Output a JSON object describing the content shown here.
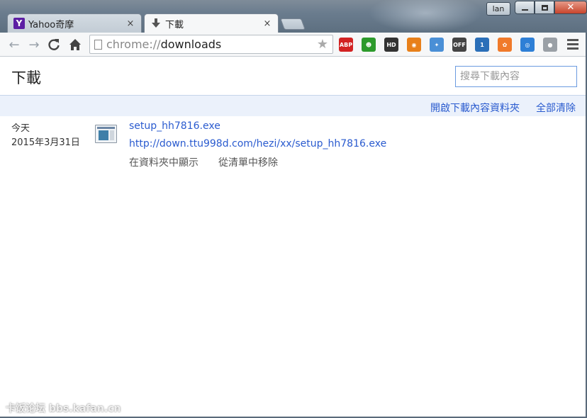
{
  "window": {
    "user_label": "lan",
    "close_glyph": "✕"
  },
  "tabs": [
    {
      "title": "Yahoo奇摩",
      "favicon": "Y",
      "icon": "yahoo-icon",
      "active": false
    },
    {
      "title": "下載",
      "favicon": "🡇",
      "icon": "download-arrow-icon",
      "active": true
    }
  ],
  "tab_close_glyph": "×",
  "toolbar": {
    "back_glyph": "←",
    "forward_glyph": "→",
    "reload_glyph": "C",
    "home_glyph": "⌂",
    "url_scheme": "chrome://",
    "url_host": "downloads",
    "star_glyph": "★",
    "extensions": [
      {
        "name": "adblock-plus-icon",
        "text": "ABP",
        "color": "#d22222"
      },
      {
        "name": "green-face-icon",
        "text": "☻",
        "color": "#2c9a2c"
      },
      {
        "name": "hd-icon",
        "text": "HD",
        "color": "#333333"
      },
      {
        "name": "orange-circle-icon",
        "text": "◉",
        "color": "#e8801a"
      },
      {
        "name": "bird-icon",
        "text": "✦",
        "color": "#4a8fd6"
      },
      {
        "name": "off-toggle-icon",
        "text": "OFF",
        "color": "#444444"
      },
      {
        "name": "badge-notify-icon",
        "text": "1",
        "color": "#2b6fb8"
      },
      {
        "name": "dots-cluster-icon",
        "text": "✿",
        "color": "#f07a2a"
      },
      {
        "name": "swirl-icon",
        "text": "◎",
        "color": "#2e7fd6"
      },
      {
        "name": "grey-shield-icon",
        "text": "●",
        "color": "#9aa0a6"
      }
    ]
  },
  "page": {
    "title": "下載",
    "search_placeholder": "搜尋下載內容",
    "actions": {
      "open_folder": "開啟下載內容資料夾",
      "clear_all": "全部清除"
    },
    "downloads": [
      {
        "date_relative": "今天",
        "date": "2015年3月31日",
        "file_name": "setup_hh7816.exe",
        "url": "http://down.ttu998d.com/hezi/xx/setup_hh7816.exe",
        "show_in_folder": "在資料夾中顯示",
        "remove_from_list": "從清單中移除"
      }
    ]
  },
  "watermark": "卡饭论坛 bbs.kafan.cn",
  "colors": {
    "link": "#2a5bcf",
    "actions_bar_bg": "#ebf1fb",
    "search_border": "#6b9be0"
  }
}
